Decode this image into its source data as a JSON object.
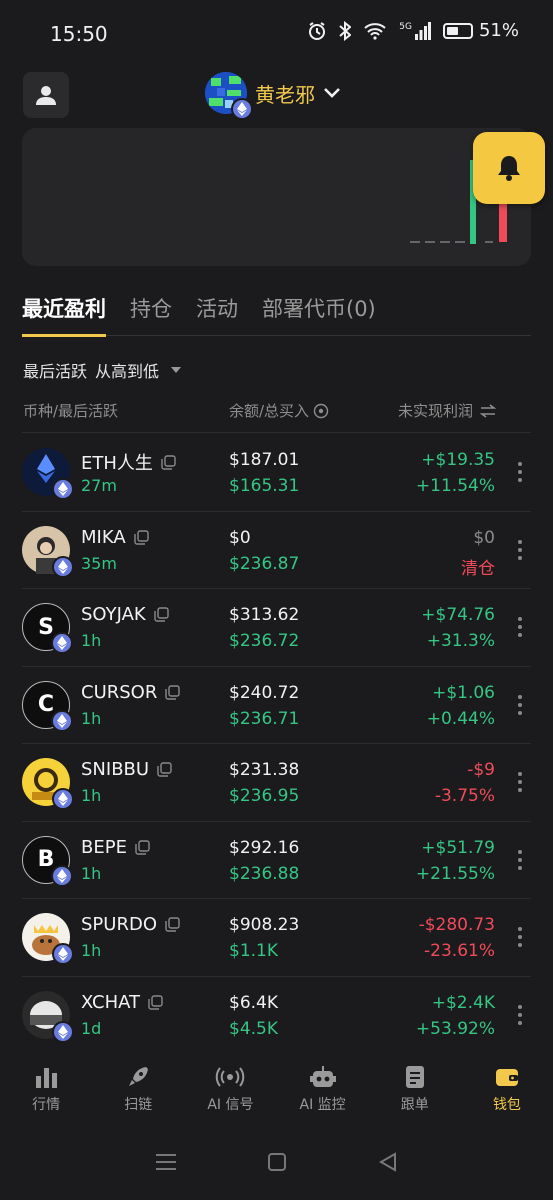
{
  "status": {
    "time": "15:50",
    "network": "5G",
    "battery_text": "51%",
    "battery_level": 0.51
  },
  "header": {
    "account_name": "黄老邪"
  },
  "tabs": [
    {
      "label": "最近盈利",
      "active": true
    },
    {
      "label": "持仓",
      "active": false
    },
    {
      "label": "活动",
      "active": false
    },
    {
      "label": "部署代币(0)",
      "active": false
    }
  ],
  "sort": {
    "field": "最后活跃",
    "order": "从高到低"
  },
  "columns": {
    "token": "币种/最后活跃",
    "balance": "余额/总买入",
    "pnl": "未实现利润"
  },
  "rows": [
    {
      "name": "ETH人生",
      "time": "27m",
      "balance": "$187.01",
      "buy": "$165.31",
      "pnl": "+$19.35",
      "pct": "+11.54%",
      "trend": "pos",
      "icon": "eth-life",
      "letter": ""
    },
    {
      "name": "MIKA",
      "time": "35m",
      "balance": "$0",
      "buy": "$236.87",
      "pnl": "$0",
      "pct": "清仓",
      "trend": "cleared",
      "icon": "mika",
      "letter": ""
    },
    {
      "name": "SOYJAK",
      "time": "1h",
      "balance": "$313.62",
      "buy": "$236.72",
      "pnl": "+$74.76",
      "pct": "+31.3%",
      "trend": "pos",
      "icon": "letter",
      "letter": "S"
    },
    {
      "name": "CURSOR",
      "time": "1h",
      "balance": "$240.72",
      "buy": "$236.71",
      "pnl": "+$1.06",
      "pct": "+0.44%",
      "trend": "pos",
      "icon": "letter",
      "letter": "C"
    },
    {
      "name": "SNIBBU",
      "time": "1h",
      "balance": "$231.38",
      "buy": "$236.95",
      "pnl": "-$9",
      "pct": "-3.75%",
      "trend": "neg",
      "icon": "snibbu",
      "letter": ""
    },
    {
      "name": "BEPE",
      "time": "1h",
      "balance": "$292.16",
      "buy": "$236.88",
      "pnl": "+$51.79",
      "pct": "+21.55%",
      "trend": "pos",
      "icon": "letter",
      "letter": "B"
    },
    {
      "name": "SPURDO",
      "time": "1h",
      "balance": "$908.23",
      "buy": "$1.1K",
      "pnl": "-$280.73",
      "pct": "-23.61%",
      "trend": "neg",
      "icon": "spurdo",
      "letter": ""
    },
    {
      "name": "XCHAT",
      "time": "1d",
      "balance": "$6.4K",
      "buy": "$4.5K",
      "pnl": "+$2.4K",
      "pct": "+53.92%",
      "trend": "pos",
      "icon": "xchat",
      "letter": ""
    }
  ],
  "nav": [
    {
      "label": "行情",
      "icon": "bar-chart-icon",
      "active": false
    },
    {
      "label": "扫链",
      "icon": "rocket-icon",
      "active": false
    },
    {
      "label": "AI 信号",
      "icon": "signal-icon",
      "active": false
    },
    {
      "label": "AI 监控",
      "icon": "robot-icon",
      "active": false
    },
    {
      "label": "跟单",
      "icon": "document-icon",
      "active": false
    },
    {
      "label": "钱包",
      "icon": "wallet-icon",
      "active": true
    }
  ],
  "colors": {
    "accent": "#f2c94c",
    "positive": "#35c684",
    "negative": "#f04b5a",
    "background": "#1b1b1d"
  }
}
